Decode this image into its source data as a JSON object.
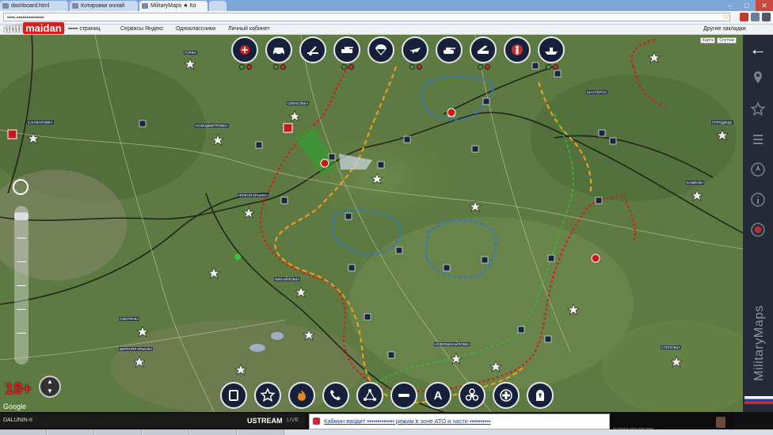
{
  "browser": {
    "tabs": [
      {
        "label": "dashboard.html"
      },
      {
        "label": "Котировки онлай"
      },
      {
        "label": "MilitaryMaps ★ Ко"
      },
      {
        "label": ""
      }
    ],
    "address": "▪▪▪▪.▪▪▪▪▪▪▪▪▪▪▪▪▪▪",
    "address_badge": "",
    "bookmarks": [
      "▪▪▪▪▪ страниц",
      "Сервисы Яндекс",
      "Одноклассники",
      "Личный кабинет"
    ],
    "bookmarks_right": "Другие закладки"
  },
  "map": {
    "logo_anti": "anti",
    "logo_maidan": "maidan",
    "maptype_buttons": [
      "Карта",
      "Спутник"
    ],
    "age_badge": "18+",
    "google": "Google",
    "colors": {
      "red_line": "#d0201a",
      "orange_line": "#e8a020",
      "green_line": "#38b838",
      "blue_line": "#2a78d8",
      "road": "#1e1b16",
      "satellite": "#5e7940"
    }
  },
  "filters_top": [
    {
      "name": "checkpoint-filter",
      "icon": "checkpoint-icon"
    },
    {
      "name": "vehicle-filter",
      "icon": "car-icon"
    },
    {
      "name": "artillery-filter",
      "icon": "artillery-icon"
    },
    {
      "name": "apc-filter",
      "icon": "apc-icon"
    },
    {
      "name": "paratroopers-filter",
      "icon": "parachute-icon"
    },
    {
      "name": "aviation-filter",
      "icon": "aircraft-icon"
    },
    {
      "name": "tank-filter",
      "icon": "tank-icon"
    },
    {
      "name": "mlrs-filter",
      "icon": "mlrs-icon"
    },
    {
      "name": "casualty-filter",
      "icon": "soldier-icon"
    },
    {
      "name": "navy-filter",
      "icon": "ship-icon"
    }
  ],
  "filters_bottom": [
    {
      "name": "square-filter",
      "icon": "square-icon",
      "text": ""
    },
    {
      "name": "star-filter",
      "icon": "star-icon",
      "text": ""
    },
    {
      "name": "fire-filter",
      "icon": "fire-icon",
      "text": ""
    },
    {
      "name": "phone-filter",
      "icon": "phone-icon",
      "text": ""
    },
    {
      "name": "network-filter",
      "icon": "network-icon",
      "text": ""
    },
    {
      "name": "minus-filter",
      "icon": "minus-icon",
      "text": ""
    },
    {
      "name": "label-a-filter",
      "icon": "letter-a-icon",
      "text": "A"
    },
    {
      "name": "biohazard-filter",
      "icon": "biohazard-icon",
      "text": ""
    },
    {
      "name": "medical-filter",
      "icon": "medical-cross-icon",
      "text": ""
    },
    {
      "name": "grave-filter",
      "icon": "grave-icon",
      "text": ""
    }
  ],
  "sidebar": {
    "back_icon": "arrow-left-icon",
    "items": [
      "pin-icon",
      "star-icon",
      "menu-icon",
      "compass-icon",
      "info-icon",
      "globe-icon"
    ],
    "brand": "MilitaryMaps"
  },
  "bottom": {
    "ustream_channel": "DALUNIN-II",
    "ustream_brand": "USTREAM",
    "ustream_live": "LIVE",
    "news_link": "Кабмин вводит ▪▪▪▪▪▪▪▪▪▪▪▪▪ режим в зоне АТО и части ▪▪▪▪▪▪▪▪▪▪",
    "video_caption": "▪▪▪ ▪▪▪▪▪▪▪▪▪▪ ▪▪▪▪▪▪▪ ▪▪▪▪▪▪ ▪▪▪▪▪▪▪"
  }
}
